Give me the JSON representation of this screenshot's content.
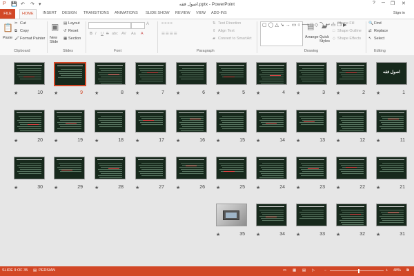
{
  "window": {
    "title": "اصول فقه.pptx - PowerPoint",
    "signin": "Sign in",
    "help": "?",
    "minimize": "─",
    "restore": "❐",
    "close": "✕"
  },
  "tabs": [
    "FILE",
    "HOME",
    "INSERT",
    "DESIGN",
    "TRANSITIONS",
    "ANIMATIONS",
    "SLIDE SHOW",
    "REVIEW",
    "VIEW",
    "ADD-INS"
  ],
  "ribbon": {
    "clipboard": {
      "paste": "Paste",
      "cut": "Cut",
      "copy": "Copy",
      "format_painter": "Format Painter",
      "label": "Clipboard"
    },
    "slides": {
      "new_slide": "New Slide",
      "layout": "Layout",
      "reset": "Reset",
      "section": "Section",
      "label": "Slides"
    },
    "font": {
      "label": "Font",
      "bold": "B",
      "italic": "I",
      "underline": "U",
      "strike": "S",
      "shadow": "abc",
      "spacing": "AV",
      "case": "Aa",
      "grow": "A",
      "color": "A"
    },
    "paragraph": {
      "text_direction": "Text Direction",
      "align_text": "Align Text",
      "convert_smartart": "Convert to SmartArt",
      "label": "Paragraph"
    },
    "drawing": {
      "arrange": "Arrange",
      "quick_styles": "Quick Styles",
      "shape_fill": "Shape Fill",
      "shape_outline": "Shape Outline",
      "shape_effects": "Shape Effects",
      "label": "Drawing"
    },
    "editing": {
      "find": "Find",
      "replace": "Replace",
      "select": "Select",
      "label": "Editing"
    }
  },
  "slides": [
    {
      "num": "1",
      "big_text": "اصول فقه"
    },
    {
      "num": "2"
    },
    {
      "num": "3"
    },
    {
      "num": "4"
    },
    {
      "num": "5"
    },
    {
      "num": "6"
    },
    {
      "num": "7"
    },
    {
      "num": "8"
    },
    {
      "num": "9",
      "selected": true
    },
    {
      "num": "10"
    },
    {
      "num": "11"
    },
    {
      "num": "12"
    },
    {
      "num": "13"
    },
    {
      "num": "14"
    },
    {
      "num": "15"
    },
    {
      "num": "16"
    },
    {
      "num": "17"
    },
    {
      "num": "18"
    },
    {
      "num": "19"
    },
    {
      "num": "20"
    },
    {
      "num": "21"
    },
    {
      "num": "22"
    },
    {
      "num": "23"
    },
    {
      "num": "24"
    },
    {
      "num": "25"
    },
    {
      "num": "26"
    },
    {
      "num": "27"
    },
    {
      "num": "28"
    },
    {
      "num": "29"
    },
    {
      "num": "30"
    },
    {
      "num": "31"
    },
    {
      "num": "32"
    },
    {
      "num": "33"
    },
    {
      "num": "34"
    },
    {
      "num": "35",
      "photo": true
    }
  ],
  "slide_star": "★",
  "status": {
    "slide_of": "SLIDE 9 OF 35",
    "language": "PERSIAN",
    "zoom": "48%",
    "zoom_minus": "−",
    "zoom_plus": "+"
  },
  "colors": {
    "accent": "#d24726",
    "slide_bg": "#17291c"
  }
}
